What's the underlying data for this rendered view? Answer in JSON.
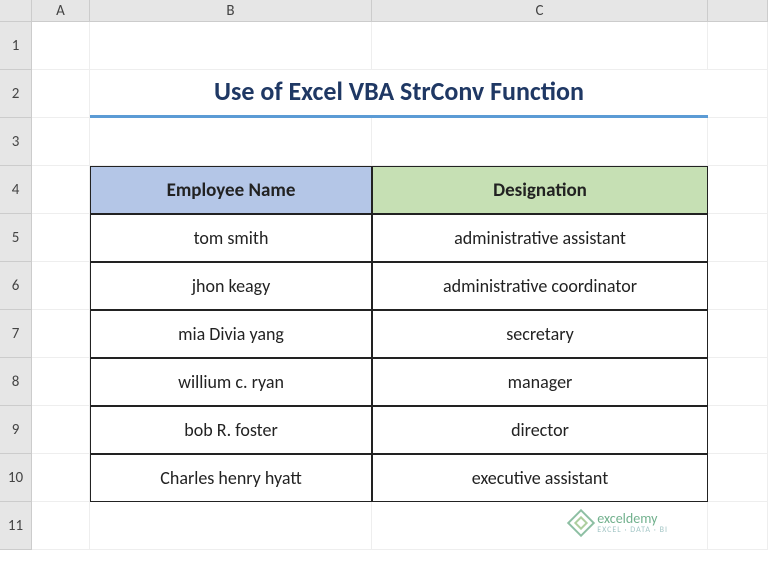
{
  "columns": [
    "A",
    "B",
    "C"
  ],
  "rows": [
    "1",
    "2",
    "3",
    "4",
    "5",
    "6",
    "7",
    "8",
    "9",
    "10",
    "11"
  ],
  "title": "Use of Excel VBA StrConv Function",
  "table": {
    "headers": {
      "b": "Employee Name",
      "c": "Designation"
    },
    "data": [
      {
        "b": "tom smith",
        "c": "administrative assistant"
      },
      {
        "b": "jhon keagy",
        "c": "administrative coordinator"
      },
      {
        "b": "mia Divia yang",
        "c": "secretary"
      },
      {
        "b": "willium c. ryan",
        "c": "manager"
      },
      {
        "b": "bob R. foster",
        "c": "director"
      },
      {
        "b": "Charles henry hyatt",
        "c": "executive assistant"
      }
    ]
  },
  "watermark": {
    "name": "exceldemy",
    "tagline": "EXCEL · DATA · BI"
  }
}
